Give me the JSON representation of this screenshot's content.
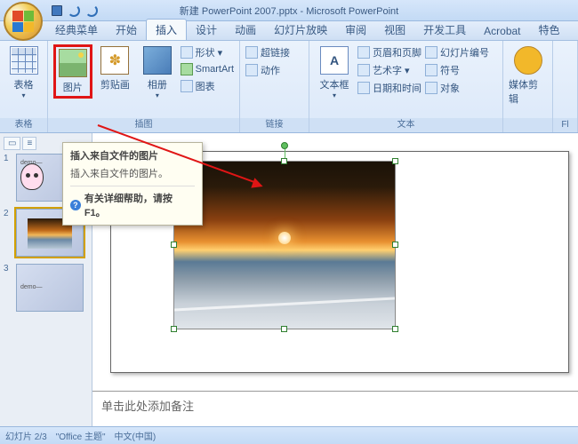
{
  "window": {
    "title": "新建 PowerPoint 2007.pptx - Microsoft PowerPoint"
  },
  "qat": {
    "save": "save-icon",
    "undo": "undo-icon",
    "redo": "redo-icon"
  },
  "menu": {
    "tabs": [
      {
        "label": "经典菜单"
      },
      {
        "label": "开始"
      },
      {
        "label": "插入"
      },
      {
        "label": "设计"
      },
      {
        "label": "动画"
      },
      {
        "label": "幻灯片放映"
      },
      {
        "label": "审阅"
      },
      {
        "label": "视图"
      },
      {
        "label": "开发工具"
      },
      {
        "label": "Acrobat"
      },
      {
        "label": "特色"
      }
    ],
    "active_index": 2
  },
  "ribbon": {
    "groups": {
      "table": {
        "label": "表格",
        "items": {
          "table": "表格"
        }
      },
      "illustration": {
        "label": "插图",
        "items": {
          "picture": "图片",
          "clipart": "剪贴画",
          "album": "相册",
          "shapes": "形状",
          "smartart": "SmartArt",
          "chart": "图表"
        }
      },
      "links": {
        "label": "链接",
        "items": {
          "hyperlink": "超链接",
          "action": "动作"
        }
      },
      "text": {
        "label": "文本",
        "items": {
          "textbox": "文本框",
          "headerfooter": "页眉和页脚",
          "wordart": "艺术字",
          "datetime": "日期和时间",
          "slidenum": "幻灯片编号",
          "symbol": "符号",
          "object": "对象"
        }
      },
      "media": {
        "label": "",
        "items": {
          "media": "媒体剪辑"
        }
      },
      "fl": {
        "label": "Fl",
        "items": {}
      }
    }
  },
  "tooltip": {
    "title": "插入来自文件的图片",
    "body": "插入来自文件的图片。",
    "help": "有关详细帮助，请按 F1。"
  },
  "thumbnails": {
    "slides": [
      {
        "num": "1",
        "title_text": "demo—"
      },
      {
        "num": "2"
      },
      {
        "num": "3",
        "title_text": "demo—"
      }
    ],
    "selected": 1
  },
  "notes": {
    "placeholder": "单击此处添加备注"
  },
  "status": {
    "slide_counter": "幻灯片 2/3",
    "theme": "\"Office 主题\"",
    "lang": "中文(中国)"
  },
  "colors": {
    "highlight": "#e01515",
    "ribbon_bg": "#e4eefb",
    "accent": "#3a7fd9"
  }
}
